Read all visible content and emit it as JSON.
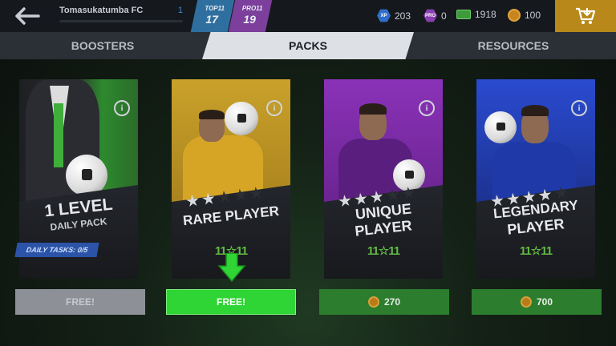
{
  "header": {
    "team_name": "Tomasukatumba FC",
    "team_level": "1",
    "top11": {
      "label": "TOP11",
      "value": "17"
    },
    "pro11": {
      "label": "PRO11",
      "value": "19"
    },
    "currencies": {
      "xp": "203",
      "pro": "0",
      "cash": "1918",
      "coins": "100"
    },
    "xp_icon_text": "XP",
    "pro_icon_text": "PRO"
  },
  "tabs": {
    "boosters": "BOOSTERS",
    "packs": "PACKS",
    "resources": "RESOURCES",
    "active": "packs"
  },
  "packs": [
    {
      "title_line1": "1 LEVEL",
      "title_line2": "DAILY PACK",
      "color": "#2e8a2e",
      "tag": "DAILY TASKS: 0/5",
      "button": "FREE!",
      "button_state": "disabled"
    },
    {
      "title_line1": "RARE PLAYER",
      "color": "#c9a12a",
      "stars_on": 2,
      "stars_total": 5,
      "logo": "11☆11",
      "button": "FREE!",
      "button_state": "highlight"
    },
    {
      "title_line1": "UNIQUE",
      "title_line2": "PLAYER",
      "color": "#7a2ea6",
      "stars_on": 3,
      "stars_total": 5,
      "logo": "11☆11",
      "button": "270",
      "button_state": "coins"
    },
    {
      "title_line1": "LEGENDARY",
      "title_line2": "PLAYER",
      "color": "#2340b8",
      "stars_on": 4,
      "stars_total": 5,
      "logo": "11☆11",
      "button": "700",
      "button_state": "coins"
    }
  ],
  "colors": {
    "accent_green": "#2fd435",
    "shop_gold": "#b8891a"
  },
  "icons": [
    "back-arrow-icon",
    "shop-cart-icon",
    "info-icon",
    "coin-icon",
    "down-arrow-icon",
    "star-icon"
  ]
}
